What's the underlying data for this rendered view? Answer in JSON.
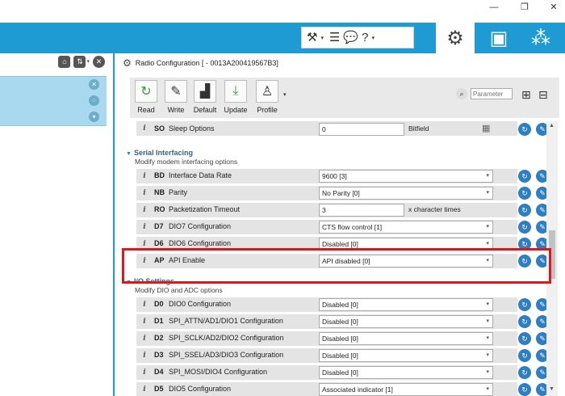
{
  "window": {
    "minimize_glyph": "—",
    "restore_glyph": "❐",
    "close_glyph": "✕"
  },
  "toolbar": {
    "tools_icons": [
      "tools-icon",
      "console-list-icon",
      "chat-icon",
      "help-icon"
    ],
    "modes": [
      "configuration-gear",
      "console-monitor",
      "network-nodes"
    ],
    "brand_color": "#1e9bd3"
  },
  "config": {
    "title": "Radio Configuration [  - 0013A200419567B3]",
    "ribbon": {
      "read": "Read",
      "write": "Write",
      "default": "Default",
      "update": "Update",
      "profile": "Profile"
    },
    "search_placeholder": "Parameter"
  },
  "rows": {
    "so": {
      "code": "SO",
      "name": "Sleep Options",
      "value": "0",
      "suffix": "Bitfield"
    },
    "bd": {
      "code": "BD",
      "name": "Interface Data Rate",
      "value": "9600 [3]"
    },
    "nb": {
      "code": "NB",
      "name": "Parity",
      "value": "No Parity [0]"
    },
    "ro": {
      "code": "RO",
      "name": "Packetization Timeout",
      "value": "3",
      "suffix": "x character times"
    },
    "d7": {
      "code": "D7",
      "name": "DIO7 Configuration",
      "value": "CTS flow control [1]"
    },
    "d6": {
      "code": "D6",
      "name": "DIO6 Configuration",
      "value": "Disabled [0]"
    },
    "ap": {
      "code": "AP",
      "name": "API Enable",
      "value": "API disabled [0]"
    },
    "d0": {
      "code": "D0",
      "name": "DIO0 Configuration",
      "value": "Disabled [0]"
    },
    "d1": {
      "code": "D1",
      "name": "SPI_ATTN/AD1/DIO1 Configuration",
      "value": "Disabled [0]"
    },
    "d2": {
      "code": "D2",
      "name": "SPI_SCLK/AD2/DIO2 Configuration",
      "value": "Disabled [0]"
    },
    "d3": {
      "code": "D3",
      "name": "SPI_SSEL/AD3/DIO3 Configuration",
      "value": "Disabled [0]"
    },
    "d4": {
      "code": "D4",
      "name": "SPI_MOSI/DIO4 Configuration",
      "value": "Disabled [0]"
    },
    "d5": {
      "code": "D5",
      "name": "DIO5 Configuration",
      "value": "Associated indicator [1]"
    }
  },
  "sections": {
    "serial": {
      "title": "Serial Interfacing",
      "desc": "Modify modem interfacing options"
    },
    "io": {
      "title": "I/O Settings",
      "desc": "Modify DIO and ADC options"
    }
  },
  "highlight_color": "#e0161b"
}
